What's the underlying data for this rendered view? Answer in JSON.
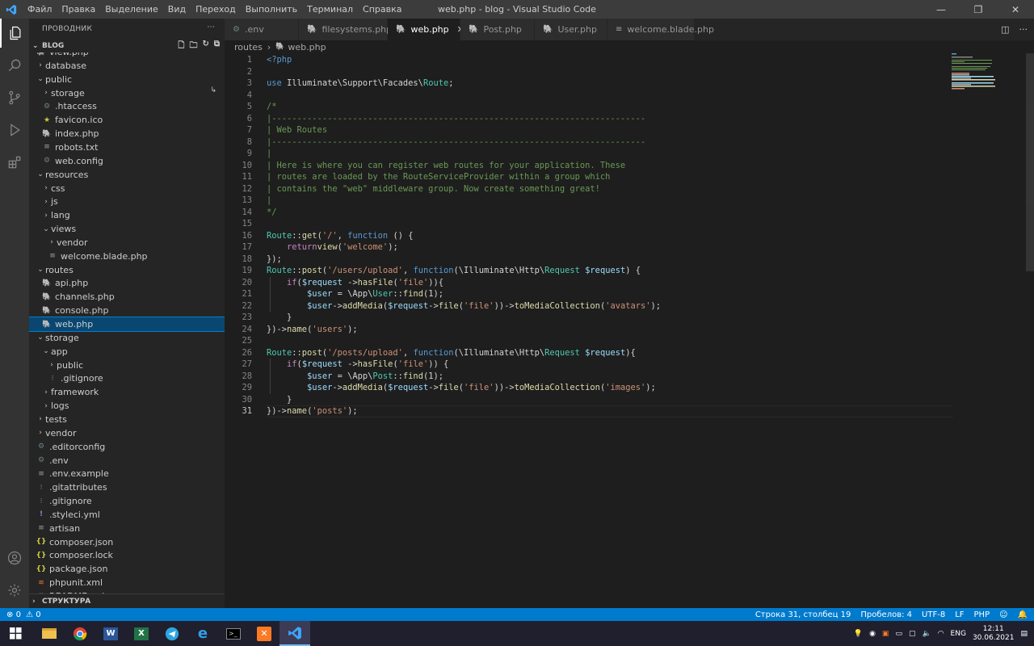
{
  "window": {
    "title": "web.php - blog - Visual Studio Code"
  },
  "menu": [
    "Файл",
    "Правка",
    "Выделение",
    "Вид",
    "Переход",
    "Выполнить",
    "Терминал",
    "Справка"
  ],
  "sidebar": {
    "header": "ПРОВОДНИК",
    "more": "···",
    "section": "BLOG",
    "outline": "СТРУКТУРА",
    "tree": [
      {
        "label": "view.php",
        "depth": 1,
        "icon": "php",
        "chev": ""
      },
      {
        "label": "database",
        "depth": 1,
        "icon": "",
        "chev": "›"
      },
      {
        "label": "public",
        "depth": 1,
        "icon": "",
        "chev": "⌄"
      },
      {
        "label": "storage",
        "depth": 2,
        "icon": "",
        "chev": "›"
      },
      {
        "label": ".htaccess",
        "depth": 2,
        "icon": "gear",
        "chev": ""
      },
      {
        "label": "favicon.ico",
        "depth": 2,
        "icon": "star",
        "chev": ""
      },
      {
        "label": "index.php",
        "depth": 2,
        "icon": "php",
        "chev": ""
      },
      {
        "label": "robots.txt",
        "depth": 2,
        "icon": "lines",
        "chev": ""
      },
      {
        "label": "web.config",
        "depth": 2,
        "icon": "gear",
        "chev": ""
      },
      {
        "label": "resources",
        "depth": 1,
        "icon": "",
        "chev": "⌄"
      },
      {
        "label": "css",
        "depth": 2,
        "icon": "",
        "chev": "›"
      },
      {
        "label": "js",
        "depth": 2,
        "icon": "",
        "chev": "›"
      },
      {
        "label": "lang",
        "depth": 2,
        "icon": "",
        "chev": "›"
      },
      {
        "label": "views",
        "depth": 2,
        "icon": "",
        "chev": "⌄"
      },
      {
        "label": "vendor",
        "depth": 3,
        "icon": "",
        "chev": "›"
      },
      {
        "label": "welcome.blade.php",
        "depth": 3,
        "icon": "lines",
        "chev": ""
      },
      {
        "label": "routes",
        "depth": 1,
        "icon": "",
        "chev": "⌄"
      },
      {
        "label": "api.php",
        "depth": 2,
        "icon": "php",
        "chev": ""
      },
      {
        "label": "channels.php",
        "depth": 2,
        "icon": "php",
        "chev": ""
      },
      {
        "label": "console.php",
        "depth": 2,
        "icon": "php",
        "chev": ""
      },
      {
        "label": "web.php",
        "depth": 2,
        "icon": "php",
        "chev": "",
        "selected": true
      },
      {
        "label": "storage",
        "depth": 1,
        "icon": "",
        "chev": "⌄"
      },
      {
        "label": "app",
        "depth": 2,
        "icon": "",
        "chev": "⌄"
      },
      {
        "label": "public",
        "depth": 3,
        "icon": "",
        "chev": "›"
      },
      {
        "label": ".gitignore",
        "depth": 3,
        "icon": "dots",
        "chev": ""
      },
      {
        "label": "framework",
        "depth": 2,
        "icon": "",
        "chev": "›"
      },
      {
        "label": "logs",
        "depth": 2,
        "icon": "",
        "chev": "›"
      },
      {
        "label": "tests",
        "depth": 1,
        "icon": "",
        "chev": "›"
      },
      {
        "label": "vendor",
        "depth": 1,
        "icon": "",
        "chev": "›"
      },
      {
        "label": ".editorconfig",
        "depth": 1,
        "icon": "gear",
        "chev": ""
      },
      {
        "label": ".env",
        "depth": 1,
        "icon": "gear",
        "chev": ""
      },
      {
        "label": ".env.example",
        "depth": 1,
        "icon": "lines",
        "chev": ""
      },
      {
        "label": ".gitattributes",
        "depth": 1,
        "icon": "dots",
        "chev": ""
      },
      {
        "label": ".gitignore",
        "depth": 1,
        "icon": "dots",
        "chev": ""
      },
      {
        "label": ".styleci.yml",
        "depth": 1,
        "icon": "excl",
        "chev": ""
      },
      {
        "label": "artisan",
        "depth": 1,
        "icon": "lines",
        "chev": ""
      },
      {
        "label": "composer.json",
        "depth": 1,
        "icon": "braces",
        "chev": ""
      },
      {
        "label": "composer.lock",
        "depth": 1,
        "icon": "braces",
        "chev": ""
      },
      {
        "label": "package.json",
        "depth": 1,
        "icon": "braces",
        "chev": ""
      },
      {
        "label": "phpunit.xml",
        "depth": 1,
        "icon": "rss",
        "chev": ""
      },
      {
        "label": "README.md",
        "depth": 1,
        "icon": "info",
        "chev": ""
      }
    ]
  },
  "tabs": [
    {
      "label": ".env",
      "icon": "gear",
      "active": false
    },
    {
      "label": "filesystems.php",
      "icon": "php",
      "active": false
    },
    {
      "label": "web.php",
      "icon": "php",
      "active": true
    },
    {
      "label": "Post.php",
      "icon": "php",
      "active": false
    },
    {
      "label": "User.php",
      "icon": "php",
      "active": false
    },
    {
      "label": "welcome.blade.php",
      "icon": "lines",
      "active": false
    }
  ],
  "breadcrumb": {
    "folder": "routes",
    "sep": "›",
    "file": "web.php"
  },
  "editor": {
    "current_line": 31,
    "lines": [
      [
        [
          "p",
          "<?php"
        ]
      ],
      [],
      [
        [
          "k",
          "use "
        ],
        [
          "",
          "Illuminate\\Support\\Facades\\"
        ],
        [
          "t",
          "Route"
        ],
        [
          "",
          ";"
        ]
      ],
      [],
      [
        [
          "c",
          "/*"
        ]
      ],
      [
        [
          "c",
          "|--------------------------------------------------------------------------"
        ]
      ],
      [
        [
          "c",
          "| Web Routes"
        ]
      ],
      [
        [
          "c",
          "|--------------------------------------------------------------------------"
        ]
      ],
      [
        [
          "c",
          "|"
        ]
      ],
      [
        [
          "c",
          "| Here is where you can register web routes for your application. These"
        ]
      ],
      [
        [
          "c",
          "| routes are loaded by the RouteServiceProvider within a group which"
        ]
      ],
      [
        [
          "c",
          "| contains the \"web\" middleware group. Now create something great!"
        ]
      ],
      [
        [
          "c",
          "|"
        ]
      ],
      [
        [
          "c",
          "*/"
        ]
      ],
      [],
      [
        [
          "t",
          "Route"
        ],
        [
          "",
          "::"
        ],
        [
          "f",
          "get"
        ],
        [
          "",
          "("
        ],
        [
          "s",
          "'/'"
        ],
        [
          "",
          ", "
        ],
        [
          "k",
          "function"
        ],
        [
          "",
          " () {"
        ]
      ],
      [
        [
          "",
          "    "
        ],
        [
          "kc",
          "return"
        ],
        [
          "",
          "",
          " "
        ],
        [
          "f",
          "view"
        ],
        [
          "",
          "("
        ],
        [
          "s",
          "'welcome'"
        ],
        [
          "",
          ");"
        ]
      ],
      [
        [
          "",
          "});"
        ]
      ],
      [
        [
          "t",
          "Route"
        ],
        [
          "",
          "::"
        ],
        [
          "f",
          "post"
        ],
        [
          "",
          "("
        ],
        [
          "s",
          "'/users/upload'"
        ],
        [
          "",
          ", "
        ],
        [
          "k",
          "function"
        ],
        [
          "",
          "(\\Illuminate\\Http\\"
        ],
        [
          "t",
          "Request"
        ],
        [
          "",
          " "
        ],
        [
          "v",
          "$request"
        ],
        [
          "",
          ") {"
        ]
      ],
      [
        [
          "",
          "    "
        ],
        [
          "kc",
          "if"
        ],
        [
          "",
          "("
        ],
        [
          "v",
          "$request"
        ],
        [
          "",
          " ->"
        ],
        [
          "f",
          "hasFile"
        ],
        [
          "",
          "("
        ],
        [
          "s",
          "'file'"
        ],
        [
          "",
          "))"
        ],
        [
          "",
          "{"
        ]
      ],
      [
        [
          "",
          "        "
        ],
        [
          "v",
          "$user"
        ],
        [
          "",
          " = \\App\\"
        ],
        [
          "t",
          "User"
        ],
        [
          "",
          "::"
        ],
        [
          "f",
          "find"
        ],
        [
          "",
          "(1);"
        ]
      ],
      [
        [
          "",
          "        "
        ],
        [
          "v",
          "$user"
        ],
        [
          "",
          "->"
        ],
        [
          "f",
          "addMedia"
        ],
        [
          "",
          "("
        ],
        [
          "v",
          "$request"
        ],
        [
          "",
          "->"
        ],
        [
          "f",
          "file"
        ],
        [
          "",
          "("
        ],
        [
          "s",
          "'file'"
        ],
        [
          "",
          "))->"
        ],
        [
          "f",
          "toMediaCollection"
        ],
        [
          "",
          "("
        ],
        [
          "s",
          "'avatars'"
        ],
        [
          "",
          ");"
        ]
      ],
      [
        [
          "",
          "    }"
        ]
      ],
      [
        [
          "",
          "})->"
        ],
        [
          "f",
          "name"
        ],
        [
          "",
          "("
        ],
        [
          "s",
          "'users'"
        ],
        [
          "",
          ");"
        ]
      ],
      [],
      [
        [
          "t",
          "Route"
        ],
        [
          "",
          "::"
        ],
        [
          "f",
          "post"
        ],
        [
          "",
          "("
        ],
        [
          "s",
          "'/posts/upload'"
        ],
        [
          "",
          ", "
        ],
        [
          "k",
          "function"
        ],
        [
          "",
          "(\\Illuminate\\Http\\"
        ],
        [
          "t",
          "Request"
        ],
        [
          "",
          " "
        ],
        [
          "v",
          "$request"
        ],
        [
          "",
          "){"
        ]
      ],
      [
        [
          "",
          "    "
        ],
        [
          "kc",
          "if"
        ],
        [
          "",
          "("
        ],
        [
          "v",
          "$request"
        ],
        [
          "",
          " ->"
        ],
        [
          "f",
          "hasFile"
        ],
        [
          "",
          "("
        ],
        [
          "s",
          "'file'"
        ],
        [
          "",
          ")) {"
        ]
      ],
      [
        [
          "",
          "        "
        ],
        [
          "v",
          "$user"
        ],
        [
          "",
          " = \\App\\"
        ],
        [
          "t",
          "Post"
        ],
        [
          "",
          "::"
        ],
        [
          "f",
          "find"
        ],
        [
          "",
          "(1);"
        ]
      ],
      [
        [
          "",
          "        "
        ],
        [
          "v",
          "$user"
        ],
        [
          "",
          "->"
        ],
        [
          "f",
          "addMedia"
        ],
        [
          "",
          "("
        ],
        [
          "v",
          "$request"
        ],
        [
          "",
          "->"
        ],
        [
          "f",
          "file"
        ],
        [
          "",
          "("
        ],
        [
          "s",
          "'file'"
        ],
        [
          "",
          "))->"
        ],
        [
          "f",
          "toMediaCollection"
        ],
        [
          "",
          "("
        ],
        [
          "s",
          "'images'"
        ],
        [
          "",
          ");"
        ]
      ],
      [
        [
          "",
          "    }"
        ]
      ],
      [
        [
          "",
          "})->"
        ],
        [
          "f",
          "name"
        ],
        [
          "",
          "("
        ],
        [
          "s",
          "'posts'"
        ],
        [
          "",
          ");"
        ]
      ]
    ]
  },
  "status": {
    "errors": "0",
    "warnings": "0",
    "position": "Строка 31, столбец 19",
    "spaces": "Пробелов: 4",
    "encoding": "UTF-8",
    "eol": "LF",
    "language": "PHP"
  },
  "taskbar": {
    "lang": "ENG",
    "time": "12:11",
    "date": "30.06.2021"
  },
  "colors": {
    "accent": "#007acc",
    "selection": "#094771",
    "php_icon": "#a074c4"
  }
}
